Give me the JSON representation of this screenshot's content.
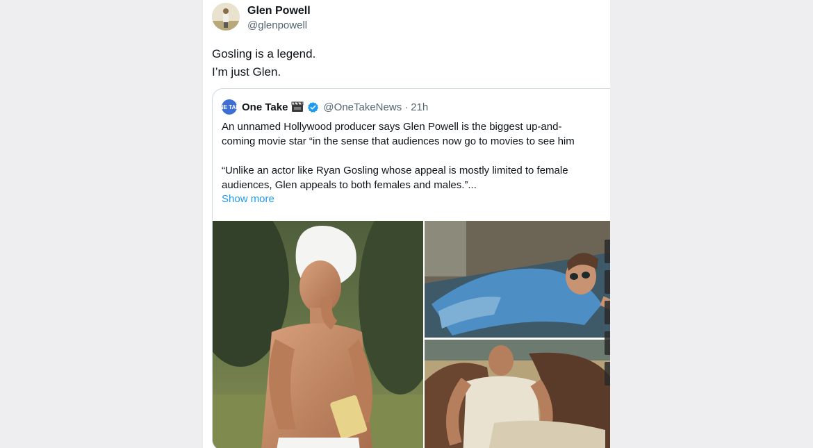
{
  "tweet": {
    "author_name": "Glen Powell",
    "author_handle": "@glenpowell",
    "text_lines": [
      "Gosling is a legend.",
      "I’m just Glen."
    ]
  },
  "quoted": {
    "avatar_text": "ONE TAKE",
    "name": "One Take",
    "name_emoji_icon": "clapperboard-icon",
    "verified_icon": "verified-badge-icon",
    "handle": "@OneTakeNews",
    "separator": "·",
    "time": "21h",
    "body_lines": [
      "An unnamed Hollywood producer says Glen Powell is the biggest up-and-",
      "coming movie star “in the sense that audiences now go to movies to see him"
    ],
    "body_lines_2": [
      "“Unlike an actor like Ryan Gosling whose appeal is mostly limited to female",
      "audiences, Glen appeals to both females and males.”..."
    ],
    "show_more": "Show more"
  },
  "colors": {
    "background": "#eeeef0",
    "link": "#1d9bf0",
    "verified": "#1d9bf0",
    "secondary_text": "#536471"
  }
}
